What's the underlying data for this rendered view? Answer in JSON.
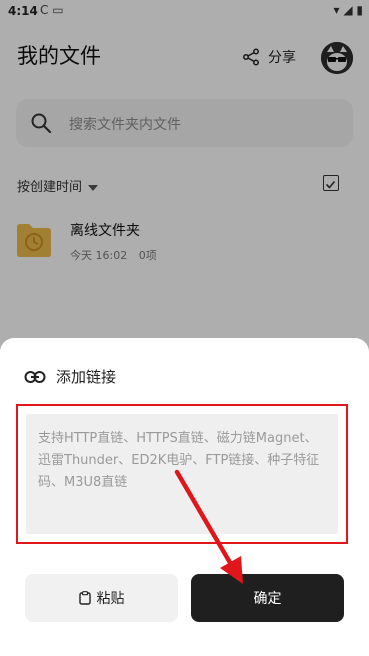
{
  "status_bar": {
    "time": "4:14",
    "left_icons": "C ▭",
    "right_icons": "▾ ◢ ▮"
  },
  "header": {
    "title": "我的文件",
    "share_label": "分享"
  },
  "search": {
    "placeholder": "搜索文件夹内文件"
  },
  "list": {
    "sort_label": "按创建时间",
    "items": [
      {
        "name": "离线文件夹",
        "date": "今天 16:02",
        "count": "0项"
      }
    ]
  },
  "dialog": {
    "title": "添加链接",
    "input_placeholder": "支持HTTP直链、HTTPS直链、磁力链Magnet、迅雷Thunder、ED2K电驴、FTP链接、种子特征码、M3U8直链",
    "paste_label": "粘贴",
    "confirm_label": "确定"
  },
  "colors": {
    "highlight_red": "#e0161b",
    "confirm_bg": "#1f1f1f",
    "folder_yellow": "#e8b84a"
  }
}
